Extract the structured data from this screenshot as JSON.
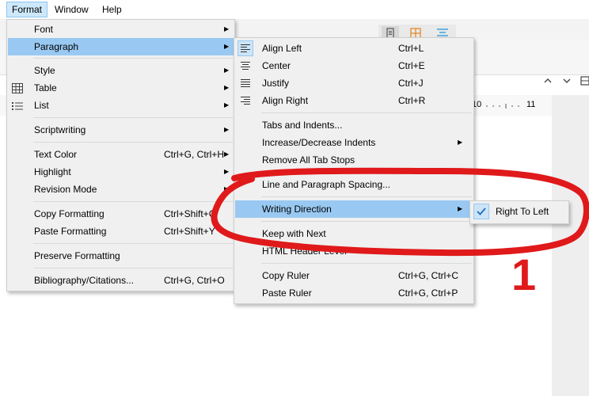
{
  "menubar": {
    "items": [
      "Format",
      "Window",
      "Help"
    ]
  },
  "format_menu": {
    "items": [
      {
        "label": "Font",
        "shortcut": ""
      },
      {
        "label": "Paragraph",
        "shortcut": ""
      },
      {
        "label": "Style",
        "shortcut": ""
      },
      {
        "label": "Table",
        "shortcut": ""
      },
      {
        "label": "List",
        "shortcut": ""
      },
      {
        "label": "Scriptwriting",
        "shortcut": ""
      },
      {
        "label": "Text Color",
        "shortcut": "Ctrl+G, Ctrl+H"
      },
      {
        "label": "Highlight",
        "shortcut": ""
      },
      {
        "label": "Revision Mode",
        "shortcut": ""
      },
      {
        "label": "Copy Formatting",
        "shortcut": "Ctrl+Shift+C"
      },
      {
        "label": "Paste Formatting",
        "shortcut": "Ctrl+Shift+Y"
      },
      {
        "label": "Preserve Formatting",
        "shortcut": ""
      },
      {
        "label": "Bibliography/Citations...",
        "shortcut": "Ctrl+G, Ctrl+O"
      }
    ]
  },
  "paragraph_menu": {
    "items": [
      {
        "label": "Align Left",
        "shortcut": "Ctrl+L"
      },
      {
        "label": "Center",
        "shortcut": "Ctrl+E"
      },
      {
        "label": "Justify",
        "shortcut": "Ctrl+J"
      },
      {
        "label": "Align Right",
        "shortcut": "Ctrl+R"
      },
      {
        "label": "Tabs and Indents...",
        "shortcut": ""
      },
      {
        "label": "Increase/Decrease Indents",
        "shortcut": ""
      },
      {
        "label": "Remove All Tab Stops",
        "shortcut": ""
      },
      {
        "label": "Line and Paragraph Spacing...",
        "shortcut": ""
      },
      {
        "label": "Writing Direction",
        "shortcut": ""
      },
      {
        "label": "Keep with Next",
        "shortcut": ""
      },
      {
        "label": "HTML Header Level",
        "shortcut": ""
      },
      {
        "label": "Copy Ruler",
        "shortcut": "Ctrl+G, Ctrl+C"
      },
      {
        "label": "Paste Ruler",
        "shortcut": "Ctrl+G, Ctrl+P"
      }
    ]
  },
  "writing_direction_menu": {
    "items": [
      {
        "label": "Right To Left",
        "checked": true
      }
    ]
  },
  "ruler": {
    "label_10": "10",
    "label_11": "11"
  },
  "annotation": {
    "number": "1",
    "color": "#e0191b"
  },
  "colors": {
    "highlight": "#99c9f2",
    "menu_bg": "#f0f0f0",
    "accent": "#1f6fbf"
  }
}
